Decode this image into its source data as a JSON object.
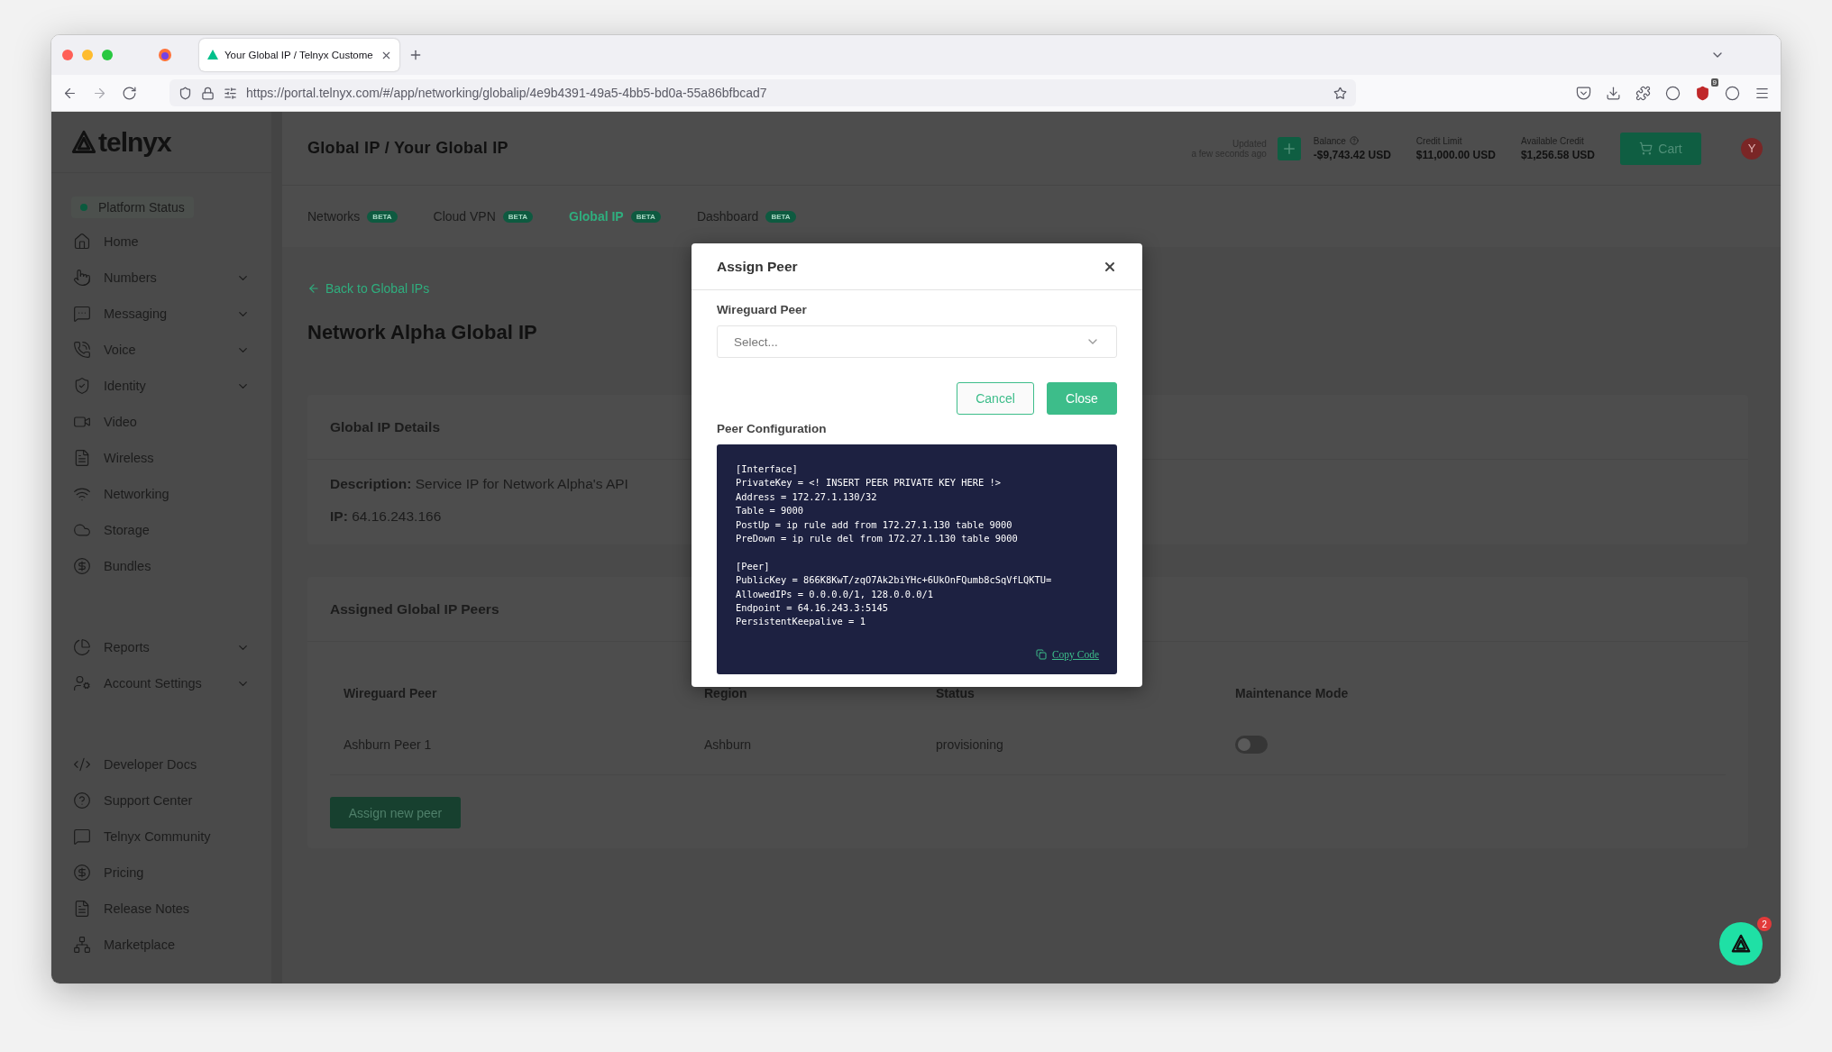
{
  "browser": {
    "tab_title": "Your Global IP / Telnyx Custome",
    "url": "https://portal.telnyx.com/#/app/networking/globalip/4e9b4391-49a5-4bb5-bd0a-55a86bfbcad7",
    "extension_badge": "9"
  },
  "sidebar": {
    "logo": "telnyx",
    "status": {
      "label": "Platform Status",
      "color": "#0b5a3e"
    },
    "groups": [
      [
        {
          "label": "Home",
          "expandable": false
        },
        {
          "label": "Numbers",
          "expandable": true
        },
        {
          "label": "Messaging",
          "expandable": true
        },
        {
          "label": "Voice",
          "expandable": true
        },
        {
          "label": "Identity",
          "expandable": true
        },
        {
          "label": "Video",
          "expandable": false
        },
        {
          "label": "Wireless",
          "expandable": false
        },
        {
          "label": "Networking",
          "expandable": false
        },
        {
          "label": "Storage",
          "expandable": false
        },
        {
          "label": "Bundles",
          "expandable": false
        }
      ],
      [
        {
          "label": "Reports",
          "expandable": true
        },
        {
          "label": "Account Settings",
          "expandable": true
        }
      ],
      [
        {
          "label": "Developer Docs",
          "expandable": false
        },
        {
          "label": "Support Center",
          "expandable": false
        },
        {
          "label": "Telnyx Community",
          "expandable": false
        },
        {
          "label": "Pricing",
          "expandable": false
        },
        {
          "label": "Release Notes",
          "expandable": false
        },
        {
          "label": "Marketplace",
          "expandable": false
        }
      ]
    ]
  },
  "header": {
    "title": "Global IP / Your Global IP",
    "updated_label": "Updated",
    "updated_time": "a few seconds ago",
    "stats": [
      {
        "label": "Balance",
        "value": "-$9,743.42 USD",
        "help": true
      },
      {
        "label": "Credit Limit",
        "value": "$11,000.00 USD",
        "help": false
      },
      {
        "label": "Available Credit",
        "value": "$1,256.58 USD",
        "help": false
      }
    ],
    "cart": "Cart",
    "avatar": "Y"
  },
  "tabs": [
    {
      "label": "Networks",
      "badge": "BETA",
      "selected": false
    },
    {
      "label": "Cloud VPN",
      "badge": "BETA",
      "selected": false
    },
    {
      "label": "Global IP",
      "badge": "BETA",
      "selected": true
    },
    {
      "label": "Dashboard",
      "badge": "BETA",
      "selected": false
    }
  ],
  "back_link": "Back to Global IPs",
  "page_title": "Network Alpha Global IP",
  "details": {
    "title": "Global IP Details",
    "fields": [
      {
        "label": "Description:",
        "value": "Service IP for Network Alpha's API"
      },
      {
        "label": "IP:",
        "value": "64.16.243.166"
      }
    ]
  },
  "peers": {
    "title": "Assigned Global IP Peers",
    "columns": [
      "Wireguard Peer",
      "Region",
      "Status",
      "Maintenance Mode"
    ],
    "rows": [
      {
        "peer": "Ashburn Peer 1",
        "region": "Ashburn",
        "status": "provisioning",
        "maintenance_on": false
      }
    ],
    "button": "Assign new peer"
  },
  "modal": {
    "title": "Assign Peer",
    "field_label": "Wireguard Peer",
    "placeholder": "Select...",
    "buttons": [
      "Cancel",
      "Close"
    ],
    "config_label": "Peer Configuration",
    "config": [
      {
        "header": "[Interface]",
        "lines": [
          "PrivateKey = <! INSERT PEER PRIVATE KEY HERE !>",
          "Address = 172.27.1.130/32",
          "Table = 9000",
          "PostUp = ip rule add from 172.27.1.130 table 9000",
          "PreDown = ip rule del from 172.27.1.130 table 9000"
        ]
      },
      {
        "header": "[Peer]",
        "lines": [
          "PublicKey = 866K8KwT/zqO7Ak2biYHc+6UkOnFQumb8cSqVfLQKTU=",
          "AllowedIPs = 0.0.0.0/1, 128.0.0.0/1",
          "Endpoint = 64.16.243.3:5145",
          "PersistentKeepalive = 1"
        ]
      }
    ],
    "copy": "Copy Code"
  },
  "chat": {
    "badge": "2"
  }
}
